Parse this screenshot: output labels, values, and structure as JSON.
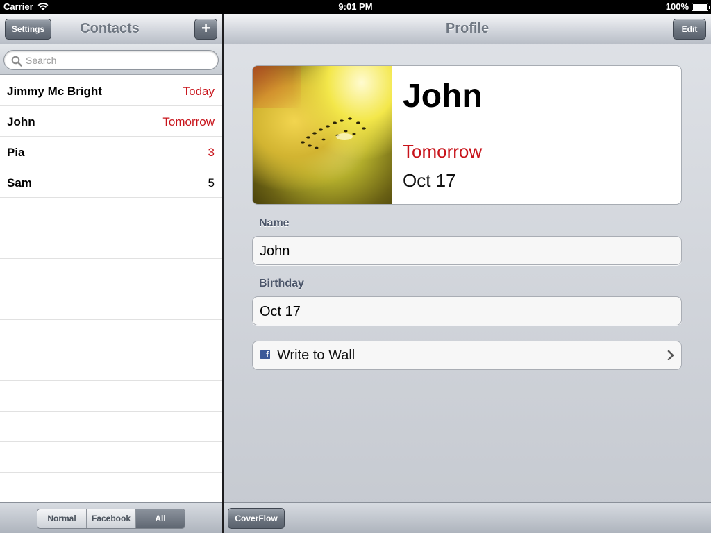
{
  "status_bar": {
    "carrier": "Carrier",
    "time": "9:01 PM",
    "battery": "100%"
  },
  "left_pane": {
    "title": "Contacts",
    "settings_button": "Settings",
    "add_button": "+",
    "search": {
      "placeholder": "Search",
      "value": ""
    },
    "contacts": [
      {
        "name": "Jimmy Mc Bright",
        "due": "Today",
        "highlight": true
      },
      {
        "name": "John",
        "due": "Tomorrow",
        "highlight": true
      },
      {
        "name": "Pia",
        "due": "3",
        "highlight": true
      },
      {
        "name": "Sam",
        "due": "5",
        "highlight": false
      }
    ],
    "filter_segments": [
      {
        "label": "Normal",
        "selected": false
      },
      {
        "label": "Facebook",
        "selected": false
      },
      {
        "label": "All",
        "selected": true
      }
    ]
  },
  "right_pane": {
    "title": "Profile",
    "edit_button": "Edit",
    "profile": {
      "name": "John",
      "when": "Tomorrow",
      "date": "Oct 17"
    },
    "name_label": "Name",
    "name_value": "John",
    "birthday_label": "Birthday",
    "birthday_value": "Oct 17",
    "wall_action": "Write to Wall",
    "coverflow_button": "CoverFlow"
  },
  "colors": {
    "due_red": "#c8141b",
    "facebook_blue": "#3b5998"
  }
}
